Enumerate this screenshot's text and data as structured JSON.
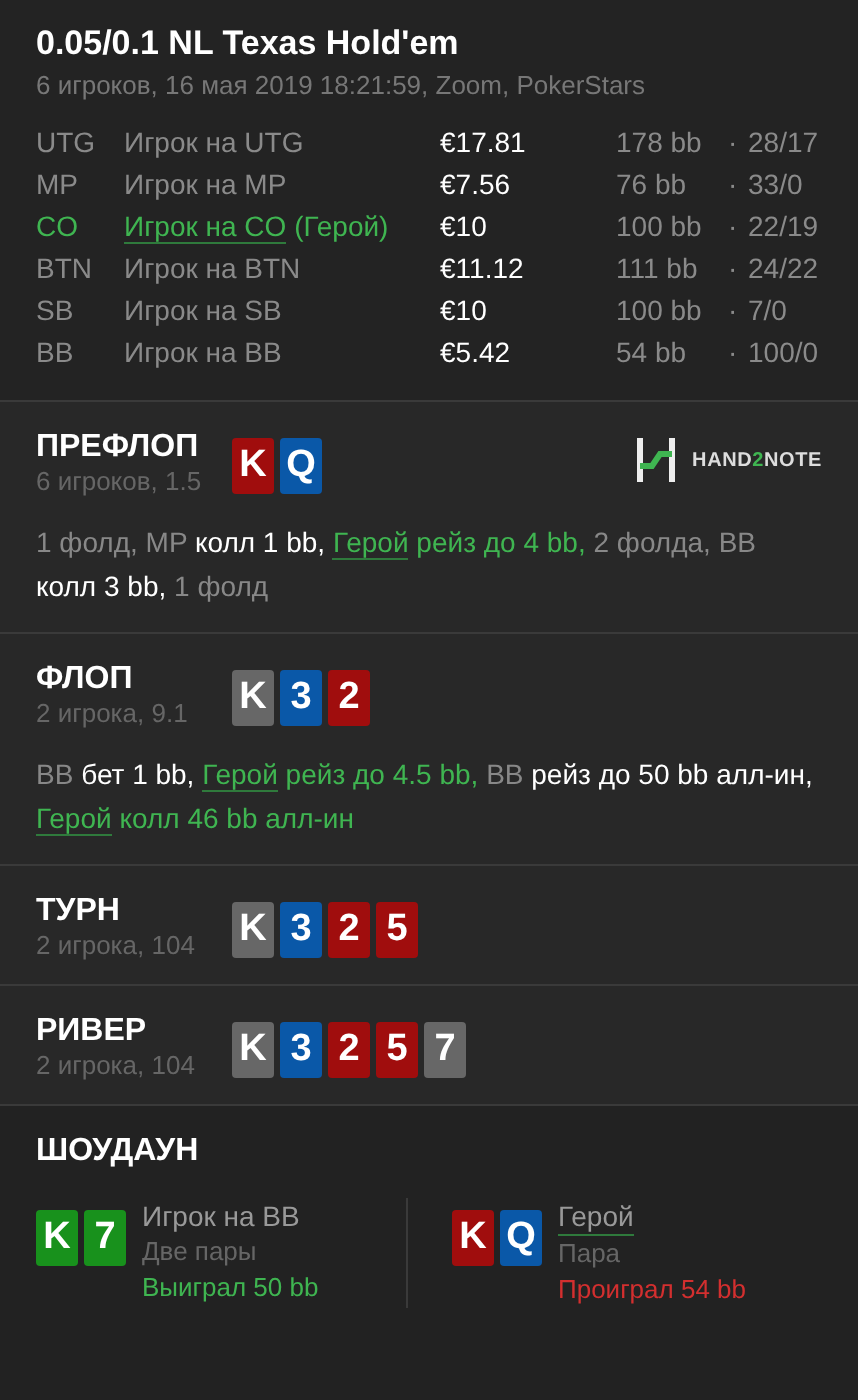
{
  "header": {
    "title": "0.05/0.1 NL Texas Hold'em",
    "subtitle": "6 игроков, 16 мая 2019 18:21:59, Zoom, PokerStars"
  },
  "players": [
    {
      "position": "UTG",
      "name": "Игрок на UTG",
      "hero": false,
      "stack": "€17.81",
      "bb": "178 bb",
      "dot": "·",
      "stats": "28/17"
    },
    {
      "position": "MP",
      "name": "Игрок на MP",
      "hero": false,
      "stack": "€7.56",
      "bb": "76 bb",
      "dot": "·",
      "stats": "33/0"
    },
    {
      "position": "CO",
      "name": "Игрок на CO",
      "tag": "(Герой)",
      "hero": true,
      "stack": "€10",
      "bb": "100 bb",
      "dot": "·",
      "stats": "22/19"
    },
    {
      "position": "BTN",
      "name": "Игрок на BTN",
      "hero": false,
      "stack": "€11.12",
      "bb": "111 bb",
      "dot": "·",
      "stats": "24/22"
    },
    {
      "position": "SB",
      "name": "Игрок на SB",
      "hero": false,
      "stack": "€10",
      "bb": "100 bb",
      "dot": "·",
      "stats": "7/0"
    },
    {
      "position": "BB",
      "name": "Игрок на BB",
      "hero": false,
      "stack": "€5.42",
      "bb": "54 bb",
      "dot": "·",
      "stats": "100/0"
    }
  ],
  "streets": [
    {
      "title": "ПРЕФЛОП",
      "info": "6 игроков, 1.5",
      "logo": {
        "parts": [
          {
            "text": "HAND",
            "accent": false
          },
          {
            "text": "2",
            "accent": true
          },
          {
            "text": "NOTE",
            "accent": false
          }
        ]
      },
      "cards": [
        {
          "rank": "K",
          "color": "#a00d0d"
        },
        {
          "rank": "Q",
          "color": "#0a58a8"
        }
      ],
      "actions": [
        {
          "kind": "muted",
          "text": "1 фолд, MP "
        },
        {
          "kind": "action",
          "text": "колл 1 bb, "
        },
        {
          "kind": "hero_name",
          "text": "Герой"
        },
        {
          "kind": "hero",
          "text": " рейз до 4 bb, "
        },
        {
          "kind": "muted",
          "text": "2 фолда, BB "
        },
        {
          "kind": "action",
          "text": "колл 3 bb, "
        },
        {
          "kind": "muted",
          "text": "1 фолд"
        }
      ]
    },
    {
      "title": "ФЛОП",
      "info": "2 игрока, 9.1",
      "cards": [
        {
          "rank": "K",
          "color": "#676767"
        },
        {
          "rank": "3",
          "color": "#0a58a8"
        },
        {
          "rank": "2",
          "color": "#a00d0d"
        }
      ],
      "actions": [
        {
          "kind": "muted",
          "text": "BB "
        },
        {
          "kind": "action",
          "text": "бет 1 bb, "
        },
        {
          "kind": "hero_name",
          "text": "Герой"
        },
        {
          "kind": "hero",
          "text": " рейз до 4.5 bb, "
        },
        {
          "kind": "muted",
          "text": "BB "
        },
        {
          "kind": "action",
          "text": "рейз до 50 bb алл-ин, "
        },
        {
          "kind": "hero_name",
          "text": "Герой"
        },
        {
          "kind": "hero",
          "text": " колл 46 bb алл-ин"
        }
      ]
    },
    {
      "title": "ТУРН",
      "info": "2 игрока, 104",
      "cards": [
        {
          "rank": "K",
          "color": "#676767"
        },
        {
          "rank": "3",
          "color": "#0a58a8"
        },
        {
          "rank": "2",
          "color": "#a00d0d"
        },
        {
          "rank": "5",
          "color": "#a00d0d"
        }
      ]
    },
    {
      "title": "РИВЕР",
      "info": "2 игрока, 104",
      "cards": [
        {
          "rank": "K",
          "color": "#676767"
        },
        {
          "rank": "3",
          "color": "#0a58a8"
        },
        {
          "rank": "2",
          "color": "#a00d0d"
        },
        {
          "rank": "5",
          "color": "#a00d0d"
        },
        {
          "rank": "7",
          "color": "#676767"
        }
      ]
    }
  ],
  "showdown": {
    "title": "ШОУДАУН",
    "hands": [
      {
        "name": "Игрок на BB",
        "hero": false,
        "hand": "Две пары",
        "result": "Выиграл 50 bb",
        "won": true,
        "cards": [
          {
            "rank": "K",
            "color": "#18911c"
          },
          {
            "rank": "7",
            "color": "#18911c"
          }
        ]
      },
      {
        "name": "Герой",
        "hero": true,
        "hand": "Пара",
        "result": "Проиграл 54 bb",
        "won": false,
        "cards": [
          {
            "rank": "K",
            "color": "#a00d0d"
          },
          {
            "rank": "Q",
            "color": "#0a58a8"
          }
        ]
      }
    ]
  }
}
